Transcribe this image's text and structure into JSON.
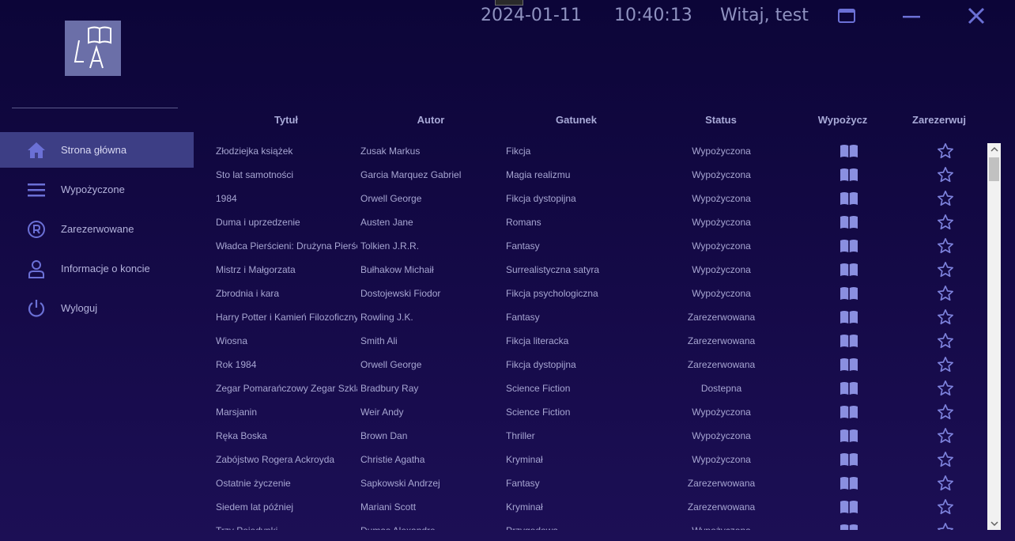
{
  "header": {
    "date": "2024-01-11",
    "time": "10:40:13",
    "greeting": "Witaj, test"
  },
  "logo": {
    "text": "LA"
  },
  "sidebar": {
    "items": [
      {
        "label": "Strona główna",
        "icon": "home-icon",
        "active": true
      },
      {
        "label": "Wypożyczone",
        "icon": "menu-icon",
        "active": false
      },
      {
        "label": "Zarezerwowane",
        "icon": "registered-icon",
        "active": false
      },
      {
        "label": "Informacje o koncie",
        "icon": "user-icon",
        "active": false
      },
      {
        "label": "Wyloguj",
        "icon": "power-icon",
        "active": false
      }
    ]
  },
  "table": {
    "columns": {
      "title": "Tytuł",
      "author": "Autor",
      "genre": "Gatunek",
      "status": "Status",
      "borrow": "Wypożycz",
      "reserve": "Zarezerwuj"
    },
    "rows": [
      {
        "title": "Złodziejka książek",
        "author": "Zusak Markus",
        "genre": "Fikcja",
        "status": "Wypożyczona"
      },
      {
        "title": "Sto lat samotności",
        "author": "Garcia Marquez Gabriel",
        "genre": "Magia realizmu",
        "status": "Wypożyczona"
      },
      {
        "title": "1984",
        "author": "Orwell George",
        "genre": "Fikcja dystopijna",
        "status": "Wypożyczona"
      },
      {
        "title": "Duma i uprzedzenie",
        "author": "Austen Jane",
        "genre": "Romans",
        "status": "Wypożyczona"
      },
      {
        "title": "Władca Pierścieni: Drużyna Pierścienia",
        "author": "Tolkien J.R.R.",
        "genre": "Fantasy",
        "status": "Wypożyczona"
      },
      {
        "title": "Mistrz i Małgorzata",
        "author": "Bułhakow Michaił",
        "genre": "Surrealistyczna satyra",
        "status": "Wypożyczona"
      },
      {
        "title": "Zbrodnia i kara",
        "author": "Dostojewski Fiodor",
        "genre": "Fikcja psychologiczna",
        "status": "Wypożyczona"
      },
      {
        "title": "Harry Potter i Kamień Filozoficzny",
        "author": "Rowling J.K.",
        "genre": "Fantasy",
        "status": "Zarezerwowana"
      },
      {
        "title": "Wiosna",
        "author": "Smith Ali",
        "genre": "Fikcja literacka",
        "status": "Zarezerwowana"
      },
      {
        "title": "Rok 1984",
        "author": "Orwell George",
        "genre": "Fikcja dystopijna",
        "status": "Zarezerwowana"
      },
      {
        "title": "Zegar Pomarańczowy Zegar Szklany",
        "author": "Bradbury Ray",
        "genre": "Science Fiction",
        "status": "Dostepna"
      },
      {
        "title": "Marsjanin",
        "author": "Weir Andy",
        "genre": "Science Fiction",
        "status": "Wypożyczona"
      },
      {
        "title": "Ręka Boska",
        "author": "Brown Dan",
        "genre": "Thriller",
        "status": "Wypożyczona"
      },
      {
        "title": "Zabójstwo Rogera Ackroyda",
        "author": "Christie Agatha",
        "genre": "Kryminał",
        "status": "Wypożyczona"
      },
      {
        "title": "Ostatnie życzenie",
        "author": "Sapkowski Andrzej",
        "genre": "Fantasy",
        "status": "Zarezerwowana"
      },
      {
        "title": "Siedem lat później",
        "author": "Mariani Scott",
        "genre": "Kryminał",
        "status": "Zarezerwowana"
      },
      {
        "title": "Trzy Pojedynki",
        "author": "Dumas Alexandre",
        "genre": "Przygodowa",
        "status": "Wypożyczona"
      }
    ]
  },
  "colors": {
    "background": "#0c0538",
    "active_nav": "#3d3e85",
    "icon": "#6b70d6",
    "text": "#a8a6d8"
  }
}
